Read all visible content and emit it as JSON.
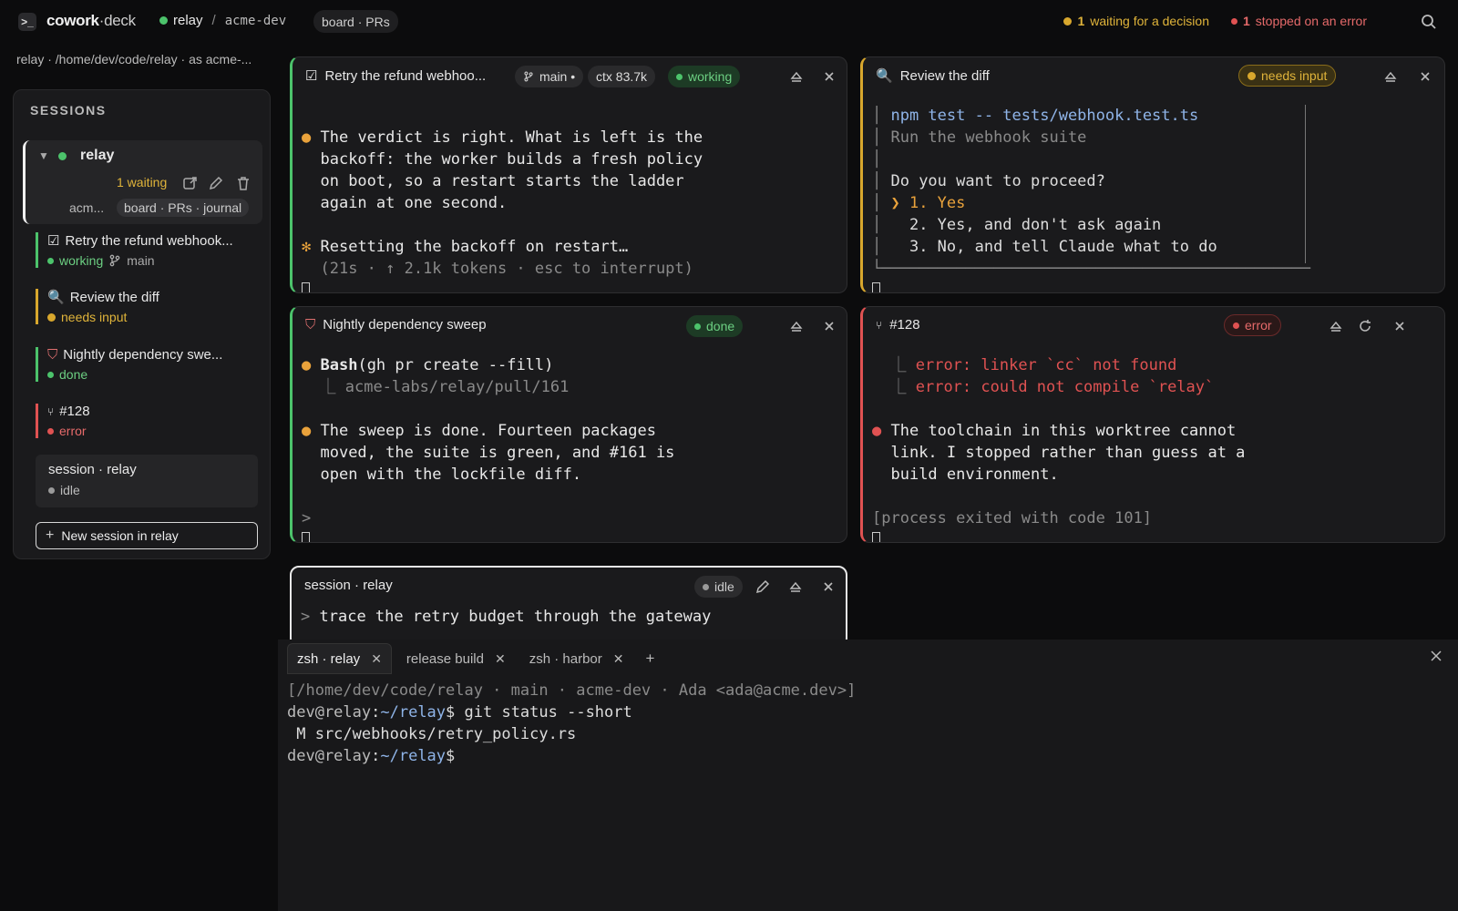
{
  "app": {
    "logo_glyph": ">_",
    "name_bold": "cowork",
    "name_rest": "·deck"
  },
  "project": {
    "name": "relay",
    "separator": "/",
    "account": "acme-dev"
  },
  "view_pill": "board · PRs",
  "alerts": {
    "waiting_count": "1",
    "waiting_label": "waiting for a decision",
    "error_count": "1",
    "error_label": "stopped on an error"
  },
  "breadcrumb": "relay · /home/dev/code/relay · as acme-...",
  "sidebar": {
    "title": "SESSIONS",
    "project": {
      "name": "relay",
      "waiting": "1 waiting",
      "account_short": "acm...",
      "views": "board · PRs · journal"
    },
    "sessions": [
      {
        "title": "Retry the refund webhook...",
        "icon": "checkbox-icon",
        "status": "working",
        "branch": "main"
      },
      {
        "title": "Review the diff",
        "icon": "magnifier-icon",
        "status": "needs input"
      },
      {
        "title": "Nightly dependency swe...",
        "icon": "shield-icon",
        "status": "done"
      },
      {
        "title": "#128",
        "icon": "fork-icon",
        "status": "error"
      },
      {
        "title": "session · relay",
        "status": "idle"
      }
    ],
    "new_session": "New session in relay"
  },
  "panes": {
    "retry": {
      "title": "Retry the refund webhoo...",
      "branch": "main •",
      "ctx": "ctx 83.7k",
      "status": "working",
      "line1": "The verdict is right. What is left is the",
      "line2": "backoff: the worker builds a fresh policy",
      "line3": "on boot, so a restart starts the ladder",
      "line4": "again at one second.",
      "spinner": "Resetting the backoff on restart…",
      "meta": "(21s · ↑ 2.1k tokens · esc to interrupt)"
    },
    "review": {
      "title": "Review the diff",
      "status": "needs input",
      "cmd": "npm test -- tests/webhook.test.ts",
      "desc": "Run the webhook suite",
      "question": "Do you want to proceed?",
      "opt1": "❯ 1. Yes",
      "opt2": "  2. Yes, and don't ask again",
      "opt3": "  3. No, and tell Claude what to do"
    },
    "nightly": {
      "title": "Nightly dependency sweep",
      "status": "done",
      "tool_bold": "Bash",
      "tool_rest": "(gh pr create --fill)",
      "tool_out": "acme-labs/relay/pull/161",
      "line1": "The sweep is done. Fourteen packages",
      "line2": "moved, the suite is green, and #161 is",
      "line3": "open with the lockfile diff.",
      "prompt": ">"
    },
    "pr128": {
      "title": "#128",
      "status": "error",
      "err1": "error: linker `cc` not found",
      "err2": "error: could not compile `relay`",
      "line1": "The toolchain in this worktree cannot",
      "line2": "link. I stopped rather than guess at a",
      "line3": "build environment.",
      "exit": "[process exited with code 101]"
    },
    "idle": {
      "title": "session · relay",
      "status": "idle",
      "prompt": ">",
      "input": "trace the retry budget through the gateway"
    }
  },
  "terminal": {
    "tabs": [
      {
        "label": "zsh · relay",
        "active": true
      },
      {
        "label": "release build",
        "active": false
      },
      {
        "label": "zsh · harbor",
        "active": false
      }
    ],
    "add": "+",
    "header": "[/home/dev/code/relay · main · acme-dev · Ada <ada@acme.dev>]",
    "user": "dev@relay",
    "colon": ":",
    "path": "~/relay",
    "dollar": "$",
    "cmd1": " git status --short",
    "out1": " M src/webhooks/retry_policy.rs"
  },
  "colors": {
    "working": "#4cc36b",
    "needs_input": "#d8a72d",
    "error": "#e05252",
    "idle": "#9a9a9a"
  }
}
